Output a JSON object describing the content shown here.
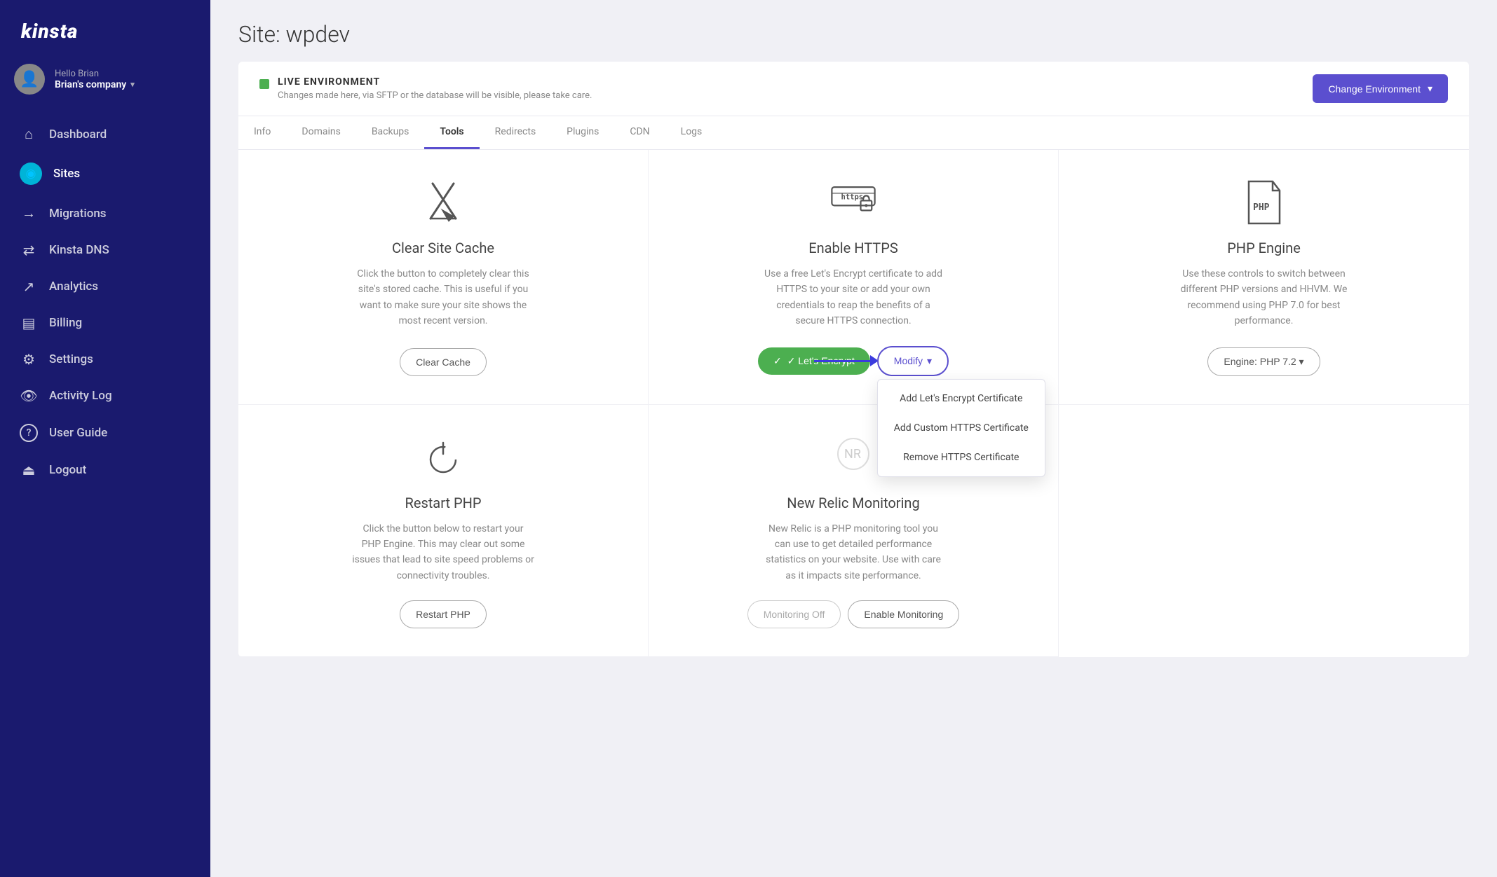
{
  "app": {
    "logo": "kinsta",
    "user": {
      "greeting": "Hello Brian",
      "company": "Brian's company"
    }
  },
  "sidebar": {
    "items": [
      {
        "id": "dashboard",
        "label": "Dashboard",
        "icon": "⌂"
      },
      {
        "id": "sites",
        "label": "Sites",
        "icon": "◉",
        "active": true
      },
      {
        "id": "migrations",
        "label": "Migrations",
        "icon": "→"
      },
      {
        "id": "kinsta-dns",
        "label": "Kinsta DNS",
        "icon": "⇄"
      },
      {
        "id": "analytics",
        "label": "Analytics",
        "icon": "↗"
      },
      {
        "id": "billing",
        "label": "Billing",
        "icon": "▤"
      },
      {
        "id": "settings",
        "label": "Settings",
        "icon": "⚙"
      },
      {
        "id": "activity-log",
        "label": "Activity Log",
        "icon": "👁"
      },
      {
        "id": "user-guide",
        "label": "User Guide",
        "icon": "?"
      },
      {
        "id": "logout",
        "label": "Logout",
        "icon": "⏏"
      }
    ]
  },
  "page": {
    "title": "Site: wpdev"
  },
  "environment": {
    "indicator": "LIVE ENVIRONMENT",
    "description": "Changes made here, via SFTP or the database will be visible, please take care.",
    "change_button": "Change Environment"
  },
  "sub_nav": {
    "items": [
      {
        "id": "info",
        "label": "Info"
      },
      {
        "id": "domains",
        "label": "Domains"
      },
      {
        "id": "backups",
        "label": "Backups"
      },
      {
        "id": "tools",
        "label": "Tools",
        "active": true
      },
      {
        "id": "redirects",
        "label": "Redirects"
      },
      {
        "id": "plugins",
        "label": "Plugins"
      },
      {
        "id": "cdn",
        "label": "CDN"
      },
      {
        "id": "logs",
        "label": "Logs"
      }
    ]
  },
  "tools": {
    "cards": [
      {
        "id": "clear-cache",
        "title": "Clear Site Cache",
        "description": "Click the button to completely clear this site's stored cache. This is useful if you want to make sure your site shows the most recent version.",
        "actions": [
          {
            "id": "clear-cache-btn",
            "label": "Clear Cache",
            "type": "outline"
          }
        ]
      },
      {
        "id": "enable-https",
        "title": "Enable HTTPS",
        "description": "Use a free Let's Encrypt certificate to add HTTPS to your site or add your own credentials to reap the benefits of a secure HTTPS connection.",
        "actions": [
          {
            "id": "lets-encrypt-btn",
            "label": "✓ Let's Encrypt",
            "type": "green"
          },
          {
            "id": "modify-btn",
            "label": "Modify ▾",
            "type": "purple-outline"
          }
        ],
        "dropdown": {
          "visible": true,
          "items": [
            {
              "id": "add-lets-encrypt",
              "label": "Add Let's Encrypt Certificate"
            },
            {
              "id": "add-custom-https",
              "label": "Add Custom HTTPS Certificate"
            },
            {
              "id": "remove-https",
              "label": "Remove HTTPS Certificate"
            }
          ]
        }
      },
      {
        "id": "php-engine",
        "title": "PHP Engine",
        "description": "Use these controls to switch between different PHP versions and HHVM. We recommend using PHP 7.0 for best performance.",
        "actions": [
          {
            "id": "engine-btn",
            "label": "Engine: PHP 7.2 ▾",
            "type": "engine"
          }
        ]
      },
      {
        "id": "restart-php",
        "title": "Restart PHP",
        "description": "Click the button below to restart your PHP Engine. This may clear out some issues that lead to site speed problems or connectivity troubles.",
        "actions": [
          {
            "id": "restart-php-btn",
            "label": "Restart PHP",
            "type": "outline"
          }
        ]
      },
      {
        "id": "new-relic",
        "title": "New Relic Monitoring",
        "description": "New Relic is a PHP monitoring tool you can use to get detailed performance statistics on your website. Use with care as it impacts site performance.",
        "actions": [
          {
            "id": "monitoring-off-btn",
            "label": "Monitoring Off",
            "type": "gray-outline"
          },
          {
            "id": "enable-monitoring-btn",
            "label": "Enable Monitoring",
            "type": "outline"
          }
        ]
      }
    ]
  }
}
